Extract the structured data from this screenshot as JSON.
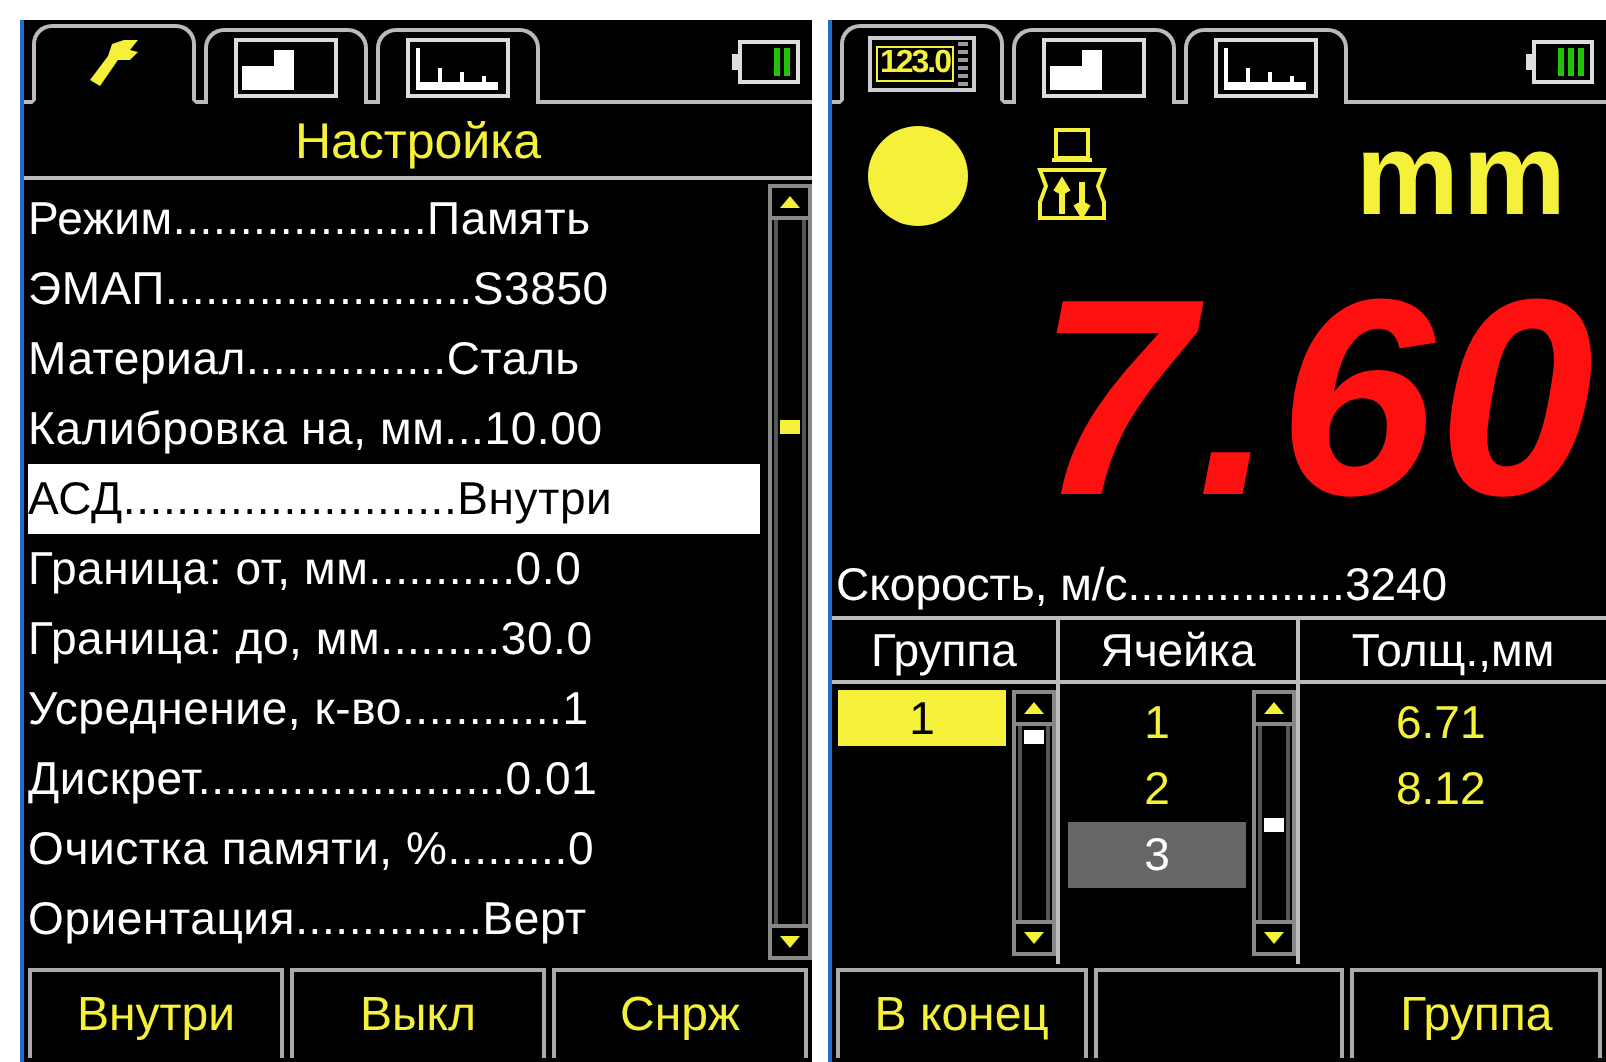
{
  "left_screen": {
    "tabs": [
      {
        "kind": "wrench",
        "selected": true
      },
      {
        "kind": "bars",
        "selected": false
      },
      {
        "kind": "ascan",
        "selected": false
      }
    ],
    "title": "Настройка",
    "menu": [
      {
        "text": "Режим...................Память",
        "selected": false
      },
      {
        "text": "ЭМАП.......................S3850",
        "selected": false
      },
      {
        "text": "Материал...............Сталь",
        "selected": false
      },
      {
        "text": "Калибровка на, мм...10.00",
        "selected": false
      },
      {
        "text": "АСД.........................Внутри",
        "selected": true
      },
      {
        "text": "Граница: от, мм...........0.0",
        "selected": false
      },
      {
        "text": "Граница: до, мм.........30.0",
        "selected": false
      },
      {
        "text": "Усреднение, к-во............1",
        "selected": false
      },
      {
        "text": "Дискрет.......................0.01",
        "selected": false
      },
      {
        "text": "Очистка памяти, %.........0",
        "selected": false
      },
      {
        "text": "Ориентация..............Верт",
        "selected": false
      }
    ],
    "buttons": [
      {
        "kind": "label",
        "label": "Внутри"
      },
      {
        "kind": "label",
        "label": "Выкл"
      },
      {
        "kind": "label",
        "label": "Снрж"
      }
    ]
  },
  "right_screen": {
    "tabs": [
      {
        "kind": "display",
        "label": "123.0",
        "selected": true
      },
      {
        "kind": "bars",
        "selected": false
      },
      {
        "kind": "ascan",
        "selected": false
      }
    ],
    "units": "mm",
    "reading": "7.60",
    "speed": "Скорость, м/с.................3240",
    "table": {
      "columns": [
        "Группа",
        "Ячейка",
        "Толщ.,мм"
      ],
      "groups": [
        {
          "label": "1",
          "selected": true
        }
      ],
      "cells": [
        {
          "label": "1",
          "selected": false
        },
        {
          "label": "2",
          "selected": false
        },
        {
          "label": "3",
          "selected": true
        }
      ],
      "thicknesses": [
        "6.71",
        "8.12"
      ]
    },
    "buttons": [
      {
        "kind": "label",
        "label": "В конец"
      },
      {
        "kind": "blank"
      },
      {
        "kind": "label",
        "label": "Группа"
      }
    ]
  }
}
